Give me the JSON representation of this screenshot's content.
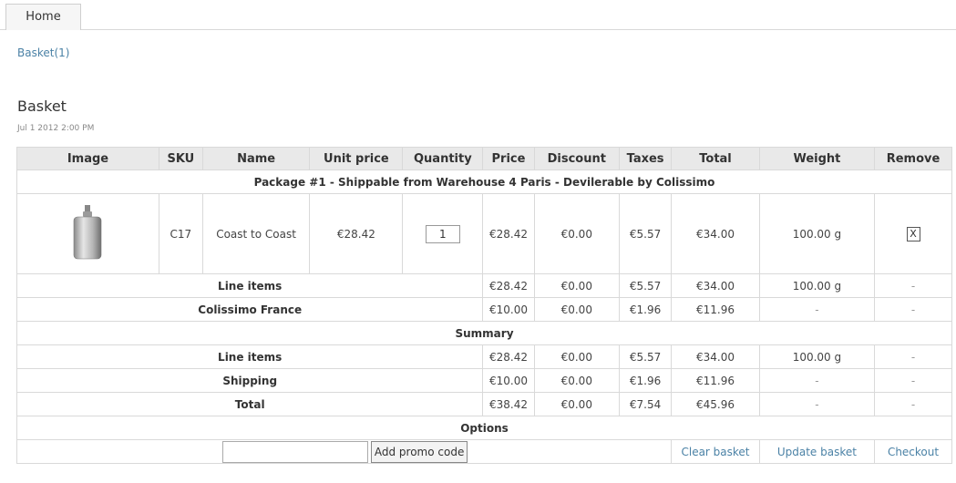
{
  "nav": {
    "home_tab": "Home"
  },
  "basket_link": "Basket(1)",
  "page": {
    "title": "Basket",
    "date": "Jul 1 2012 2:00 PM"
  },
  "table": {
    "headers": {
      "image": "Image",
      "sku": "SKU",
      "name": "Name",
      "unit_price": "Unit price",
      "quantity": "Quantity",
      "price": "Price",
      "discount": "Discount",
      "taxes": "Taxes",
      "total": "Total",
      "weight": "Weight",
      "remove": "Remove"
    },
    "package_title": "Package #1 - Shippable from Warehouse 4 Paris - Devilerable by Colissimo",
    "item": {
      "image_icon": "bottle-icon",
      "sku": "C17",
      "name": "Coast to Coast",
      "unit_price": "€28.42",
      "quantity": "1",
      "price": "€28.42",
      "discount": "€0.00",
      "taxes": "€5.57",
      "total": "€34.00",
      "weight": "100.00 g",
      "remove": "X"
    },
    "package_line_items": {
      "label": "Line items",
      "price": "€28.42",
      "discount": "€0.00",
      "taxes": "€5.57",
      "total": "€34.00",
      "weight": "100.00 g",
      "remove": "-"
    },
    "package_shipping": {
      "label": "Colissimo France",
      "price": "€10.00",
      "discount": "€0.00",
      "taxes": "€1.96",
      "total": "€11.96",
      "weight": "-",
      "remove": "-"
    },
    "summary_title": "Summary",
    "summary_line_items": {
      "label": "Line items",
      "price": "€28.42",
      "discount": "€0.00",
      "taxes": "€5.57",
      "total": "€34.00",
      "weight": "100.00 g",
      "remove": "-"
    },
    "summary_shipping": {
      "label": "Shipping",
      "price": "€10.00",
      "discount": "€0.00",
      "taxes": "€1.96",
      "total": "€11.96",
      "weight": "-",
      "remove": "-"
    },
    "summary_total": {
      "label": "Total",
      "price": "€38.42",
      "discount": "€0.00",
      "taxes": "€7.54",
      "total": "€45.96",
      "weight": "-",
      "remove": "-"
    },
    "options_title": "Options",
    "options": {
      "promo_value": "",
      "promo_button": "Add promo code",
      "clear_basket": "Clear basket",
      "update_basket": "Update basket",
      "checkout": "Checkout"
    }
  },
  "colors": {
    "link": "#4b82a6",
    "header_bg": "#e9e9e9",
    "border": "#d9d9d9"
  }
}
